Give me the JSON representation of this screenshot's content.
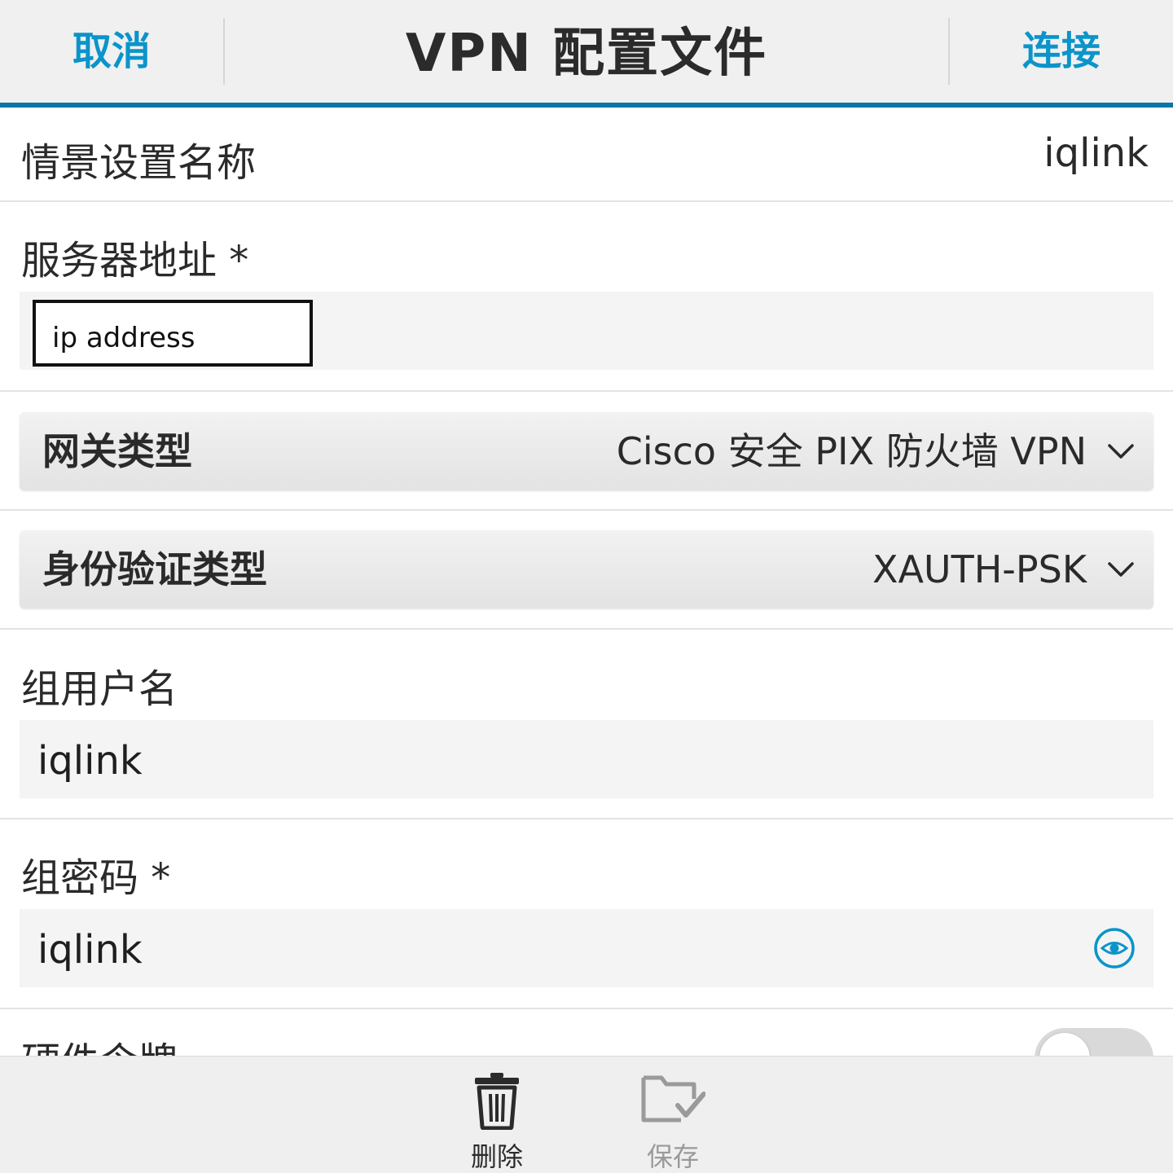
{
  "titlebar": {
    "cancel_label": "取消",
    "title": "VPN 配置文件",
    "connect_label": "连接"
  },
  "form": {
    "profile_name": {
      "label": "情景设置名称",
      "value": "iqlink"
    },
    "server_address": {
      "label": "服务器地址 *",
      "value": "ip address"
    },
    "gateway_type": {
      "label": "网关类型",
      "value": "Cisco 安全 PIX 防火墙 VPN"
    },
    "auth_type": {
      "label": "身份验证类型",
      "value": "XAUTH-PSK"
    },
    "group_username": {
      "label": "组用户名",
      "value": "iqlink"
    },
    "group_password": {
      "label": "组密码 *",
      "value": "iqlink",
      "show_password_icon": "eye-icon"
    },
    "hardware_token": {
      "label": "硬件令牌",
      "toggle_on": false
    }
  },
  "actionbar": {
    "delete_label": "删除",
    "delete_icon": "trash-icon",
    "save_label": "保存",
    "save_icon": "folder-check-icon",
    "save_enabled": false
  },
  "colors": {
    "accent": "#0b94ca",
    "accent_bar": "#0a75a8",
    "titlebar_bg": "#f0f0f0",
    "field_bg": "#f4f4f4",
    "actionbar_bg": "#efefef",
    "disabled_text": "#9a9a9a"
  }
}
